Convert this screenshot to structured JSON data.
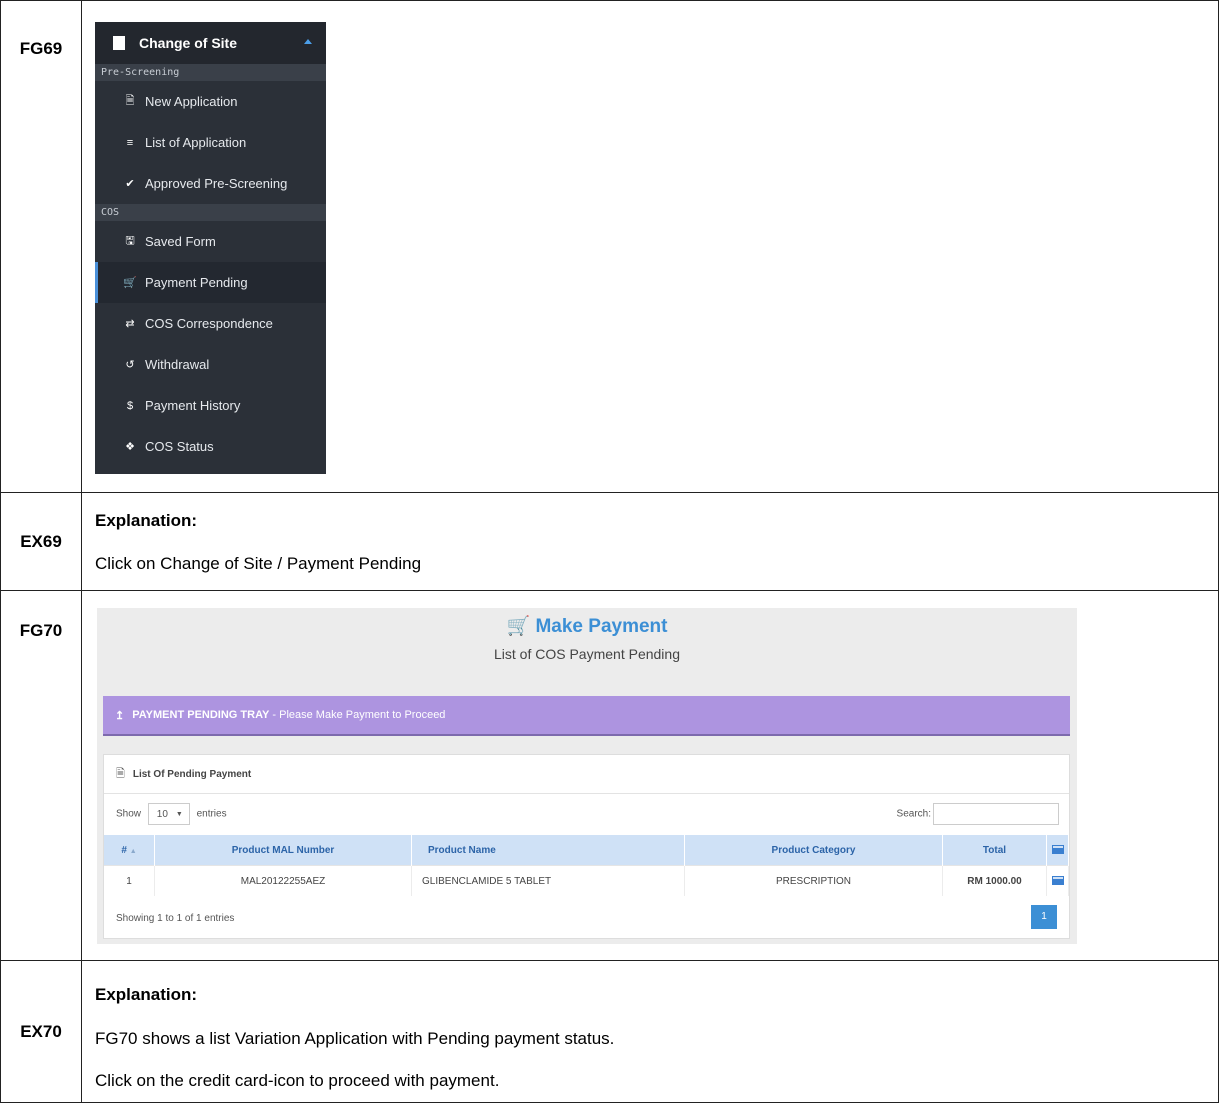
{
  "rows": {
    "fg69": "FG69",
    "ex69": "EX69",
    "fg70": "FG70",
    "ex70": "EX70"
  },
  "sidebar": {
    "header": "Change of Site",
    "section1": "Pre-Screening",
    "items1": [
      {
        "label": "New Application",
        "icon": "file-icon"
      },
      {
        "label": "List of Application",
        "icon": "list-icon"
      },
      {
        "label": "Approved Pre-Screening",
        "icon": "check-icon"
      }
    ],
    "section2": "COS",
    "items2": [
      {
        "label": "Saved Form",
        "icon": "save-icon"
      },
      {
        "label": "Payment Pending",
        "icon": "cart-icon",
        "active": true
      },
      {
        "label": "COS Correspondence",
        "icon": "exchange-icon"
      },
      {
        "label": "Withdrawal",
        "icon": "undo-icon"
      },
      {
        "label": "Payment History",
        "icon": "dollar-icon"
      },
      {
        "label": "COS Status",
        "icon": "info-icon"
      }
    ]
  },
  "ex69": {
    "heading": "Explanation:",
    "text": "Click on Change of Site / Payment Pending"
  },
  "payment": {
    "title": "Make Payment",
    "subtitle": "List of COS Payment Pending",
    "tray_bold": "PAYMENT PENDING TRAY",
    "tray_rest": " - Please Make Payment to Proceed",
    "list_title": "List Of Pending Payment",
    "show_label": "Show",
    "entries_value": "10",
    "entries_label": "entries",
    "search_label": "Search:",
    "columns": [
      "#",
      "Product MAL Number",
      "Product Name",
      "Product Category",
      "Total"
    ],
    "rows": [
      {
        "no": "1",
        "mal": "MAL20122255AEZ",
        "name": "GLIBENCLAMIDE 5 TABLET",
        "category": "PRESCRIPTION",
        "total": "RM 1000.00"
      }
    ],
    "showing": "Showing 1 to 1 of 1 entries",
    "page": "1",
    "accent": "#3c8fd5",
    "tray_color": "#ad94e0"
  },
  "ex70": {
    "heading": "Explanation:",
    "line1": "FG70 shows a list Variation Application with Pending payment status.",
    "line2": "Click on the credit card-icon to proceed with payment."
  }
}
